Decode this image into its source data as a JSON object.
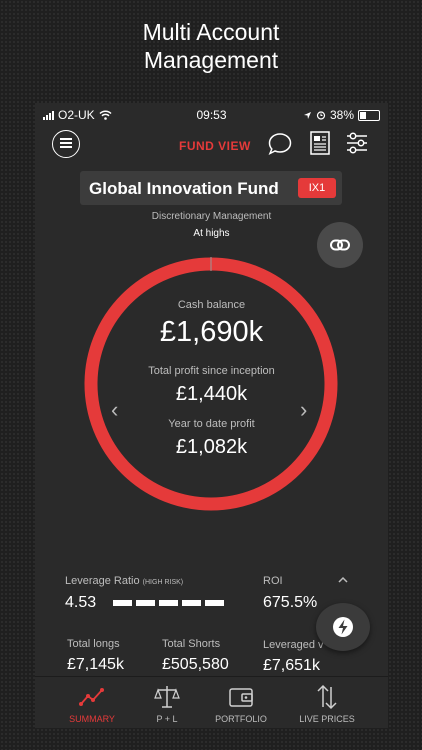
{
  "promo": {
    "line1": "Multi Account",
    "line2": "Management"
  },
  "status_bar": {
    "carrier": "O2-UK",
    "time": "09:53",
    "battery": "38%"
  },
  "header": {
    "title": "FUND VIEW"
  },
  "fund": {
    "name": "Global Innovation Fund",
    "code": "IX1",
    "management": "Discretionary Management",
    "state": "At highs"
  },
  "summary": {
    "cash_label": "Cash balance",
    "cash_value": "£1,690k",
    "profit_label": "Total profit since inception",
    "profit_value": "£1,440k",
    "ytd_label": "Year to date profit",
    "ytd_value": "£1,082k",
    "ring_fill_fraction": 0.999
  },
  "stats": {
    "leverage_label": "Leverage Ratio",
    "leverage_risk": "(HIGH RISK)",
    "leverage_value": "4.53",
    "leverage_bar_filled": 5,
    "roi_label": "ROI",
    "roi_value": "675.5%",
    "longs_label": "Total longs",
    "longs_value": "£7,145k",
    "shorts_label": "Total Shorts",
    "shorts_value": "£505,580",
    "leveraged_label": "Leveraged v",
    "leveraged_value": "£7,651k"
  },
  "tabs": [
    {
      "label": "SUMMARY",
      "icon": "line-chart-icon",
      "active": true
    },
    {
      "label": "P + L",
      "icon": "scales-icon",
      "active": false
    },
    {
      "label": "PORTFOLIO",
      "icon": "wallet-icon",
      "active": false
    },
    {
      "label": "LIVE PRICES",
      "icon": "up-down-arrows-icon",
      "active": false
    }
  ],
  "colors": {
    "accent": "#e53a3a",
    "background": "#2a2a2a"
  }
}
